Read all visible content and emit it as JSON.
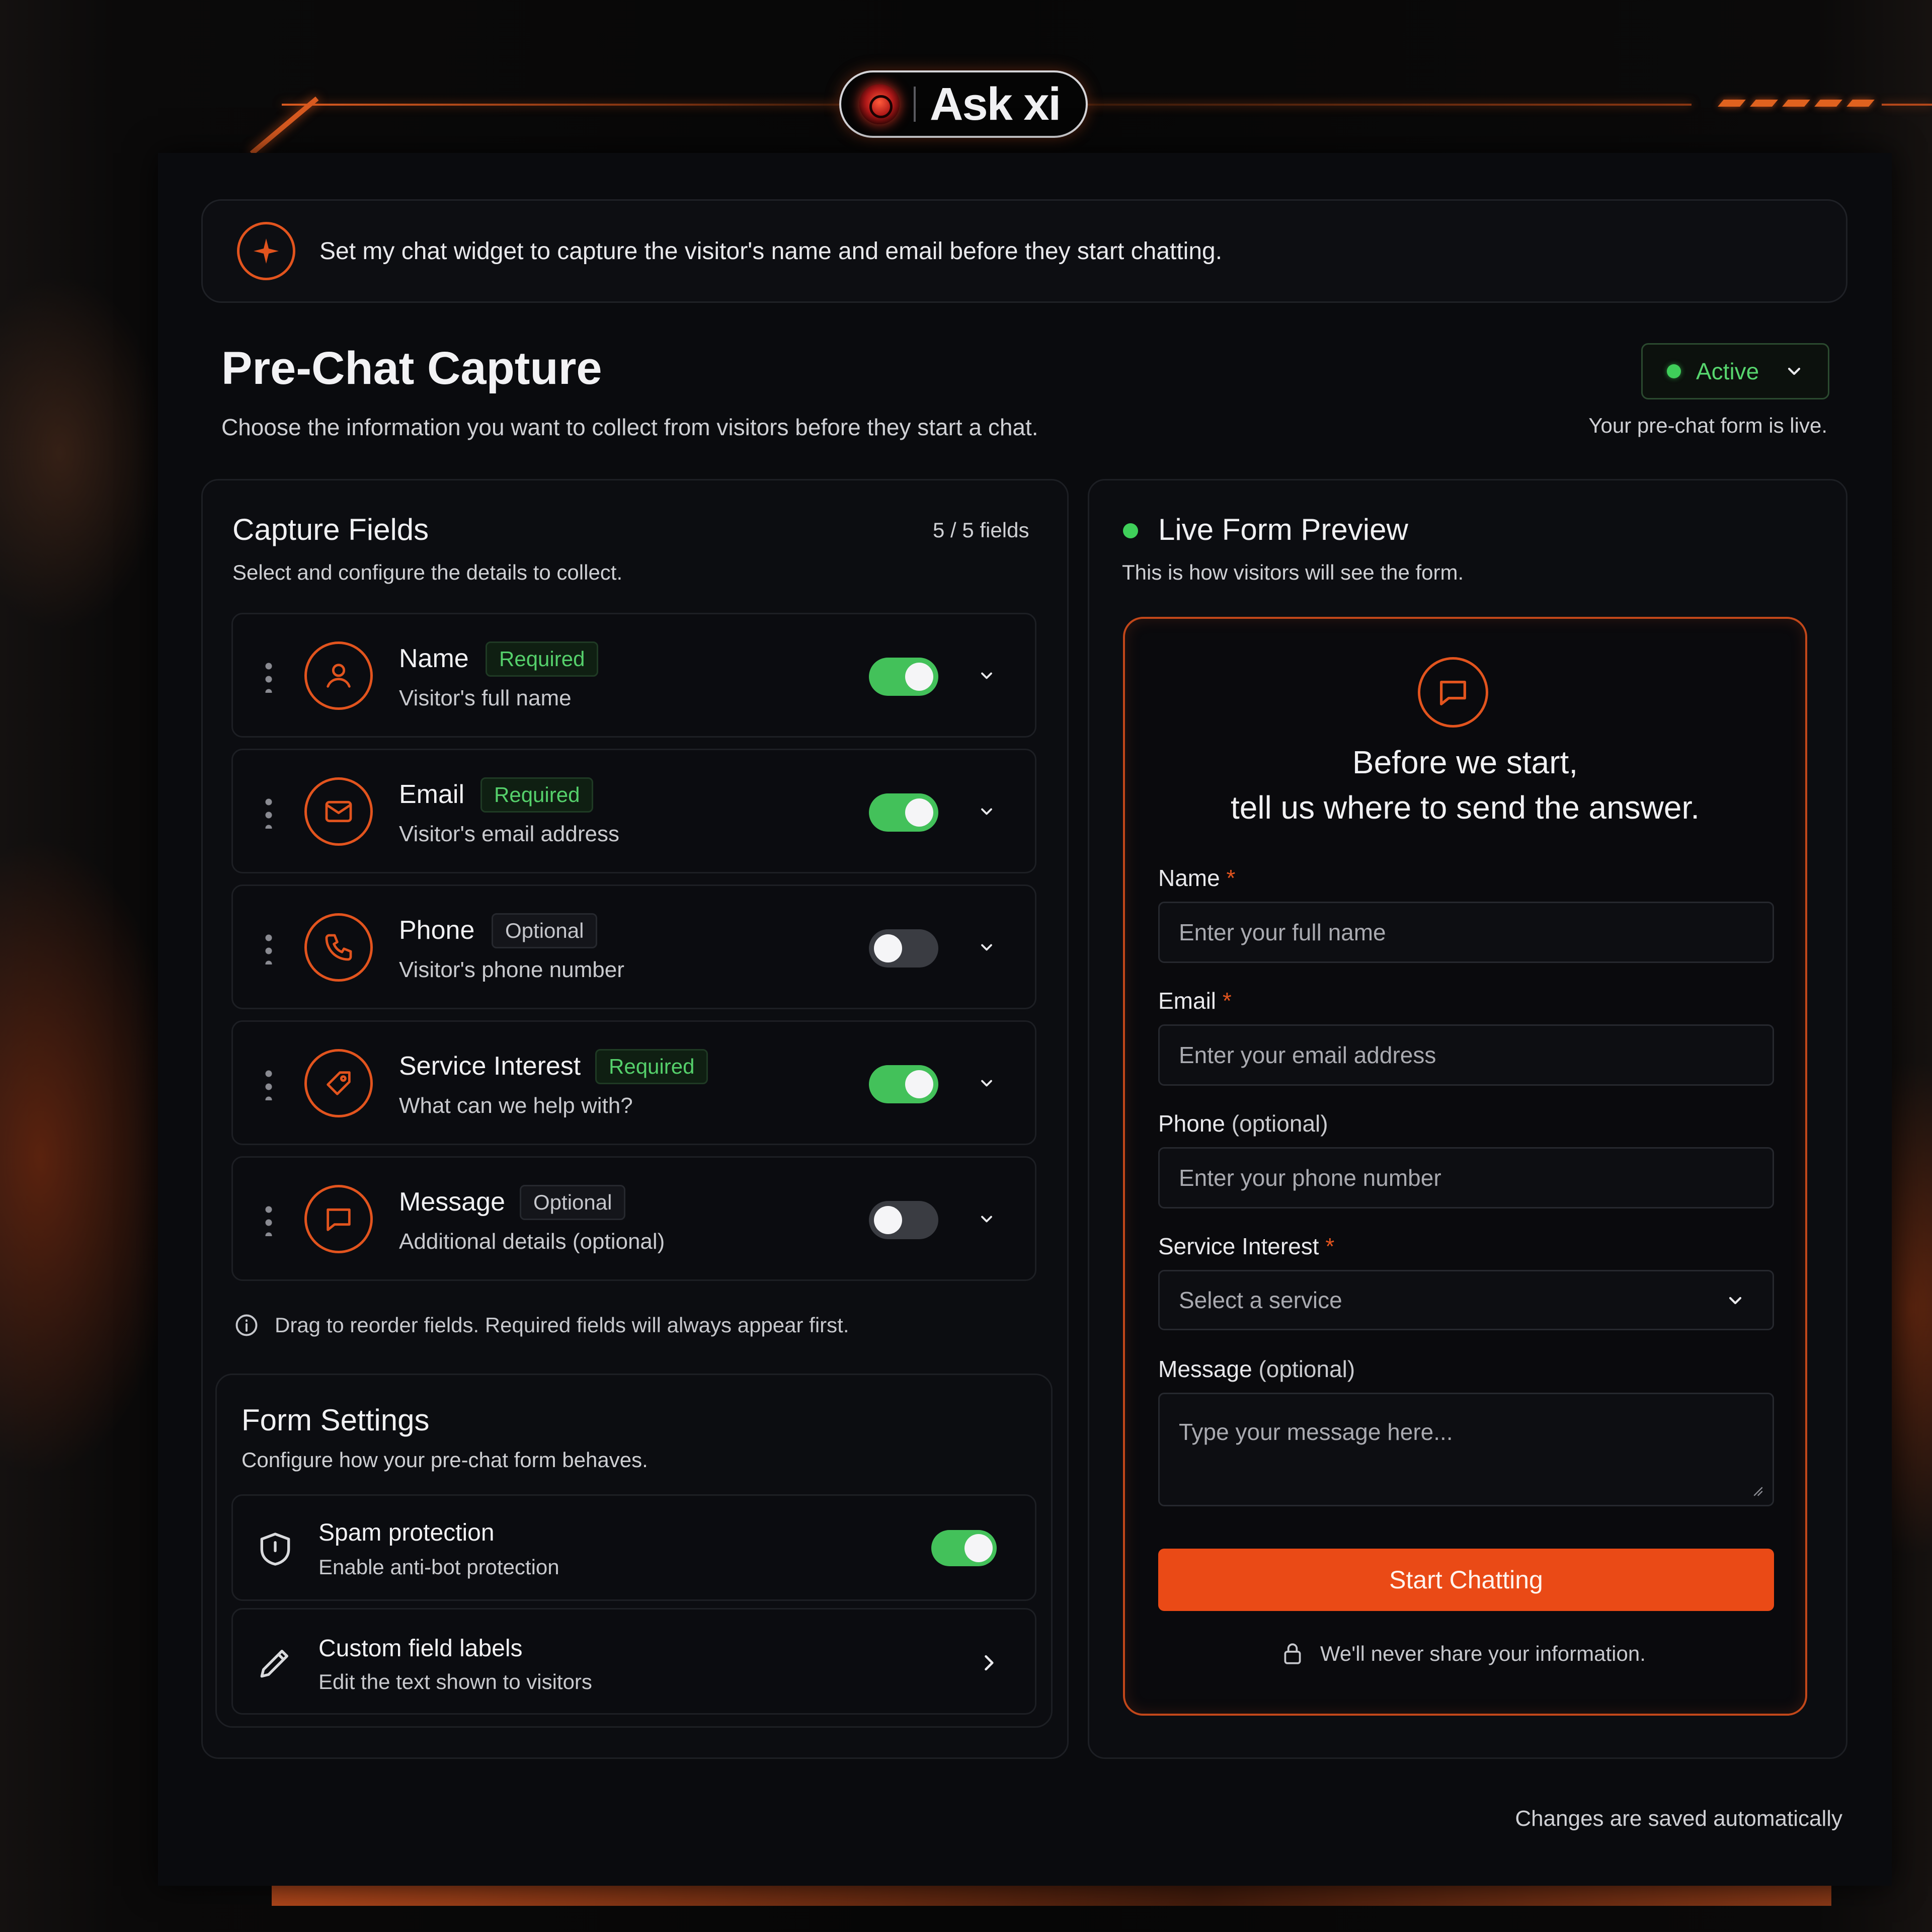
{
  "brand": {
    "name": "Ask xi"
  },
  "prompt": {
    "text": "Set my chat widget to capture the visitor's name and email before they start chatting."
  },
  "header": {
    "title": "Pre-Chat Capture",
    "subtitle": "Choose the information you want to collect from visitors before they start a chat.",
    "status": {
      "label": "Active",
      "hint": "Your pre-chat form is live.",
      "color": "#3fcf5a"
    }
  },
  "capture": {
    "title": "Capture Fields",
    "count": "5 / 5 fields",
    "description": "Select and configure the details to collect.",
    "fields": [
      {
        "label": "Name",
        "badge": "Required",
        "sub": "Visitor's full name",
        "enabled": true,
        "icon": "user-icon"
      },
      {
        "label": "Email",
        "badge": "Required",
        "sub": "Visitor's email address",
        "enabled": true,
        "icon": "mail-icon"
      },
      {
        "label": "Phone",
        "badge": "Optional",
        "sub": "Visitor's phone number",
        "enabled": false,
        "icon": "phone-icon"
      },
      {
        "label": "Service Interest",
        "badge": "Required",
        "sub": "What can we help with?",
        "enabled": true,
        "icon": "tag-icon"
      },
      {
        "label": "Message",
        "badge": "Optional",
        "sub": "Additional details (optional)",
        "enabled": false,
        "icon": "message-icon"
      }
    ],
    "hint": "Drag to reorder fields. Required fields will always appear first."
  },
  "settings": {
    "title": "Form Settings",
    "description": "Configure how your pre-chat form behaves.",
    "spam": {
      "label": "Spam protection",
      "sub": "Enable anti-bot protection",
      "enabled": true
    },
    "labels": {
      "label": "Custom field labels",
      "sub": "Edit the text shown to visitors"
    }
  },
  "preview": {
    "title": "Live Form Preview",
    "description": "This is how visitors will see the form.",
    "heading_line1": "Before we start,",
    "heading_line2": "tell us where to send the answer.",
    "name": {
      "label": "Name",
      "star": "*",
      "placeholder": "Enter your full name"
    },
    "email": {
      "label": "Email",
      "star": "*",
      "placeholder": "Enter your email address"
    },
    "phone": {
      "label": "Phone",
      "suffix": "(optional)",
      "placeholder": "Enter your phone number"
    },
    "service": {
      "label": "Service Interest",
      "star": "*",
      "placeholder": "Select a service"
    },
    "message": {
      "label": "Message",
      "suffix": "(optional)",
      "placeholder": "Type your message here..."
    },
    "submit": "Start Chatting",
    "privacy": "We'll never share your information."
  },
  "footer": {
    "autosave": "Changes are saved automatically"
  },
  "colors": {
    "accent": "#e2541e",
    "success": "#43c15a",
    "background": "#0a0b0e"
  }
}
